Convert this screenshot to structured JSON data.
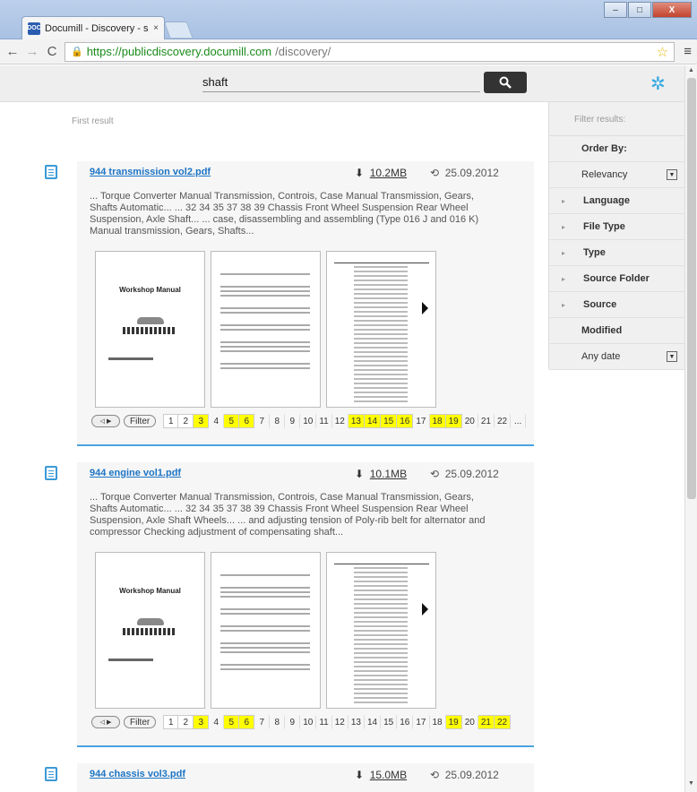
{
  "browser": {
    "tab_title": "Documill - Discovery - sha",
    "tab_close": "×",
    "favicon": "DOC",
    "url_https": "https://publicdiscovery.documill.com",
    "url_path": "/discovery/",
    "controls": {
      "minimize": "–",
      "maximize": "□",
      "close": "X"
    }
  },
  "search": {
    "query": "shaft",
    "button_icon": "search-icon"
  },
  "first_result_label": "First result",
  "results": [
    {
      "title": "944 transmission vol2.pdf",
      "size": "10.2MB",
      "date": "25.09.2012",
      "snippet": "... Torque Converter Manual Transmission, Controis, Case Manual Transmission, Gears, Shafts Automatic... ... 32 34 35 37 38 39 Chassis Front Wheel Suspension Rear Wheel Suspension, Axle Shaft... ... case, disassembling and assembling (Type 016 J and 016 K) Manual transmission, Gears, Shafts...",
      "thumb_title": "Workshop Manual",
      "filter_label": "Filter",
      "pages": [
        {
          "n": "1",
          "hl": false,
          "boxed": true
        },
        {
          "n": "2",
          "hl": false,
          "boxed": true
        },
        {
          "n": "3",
          "hl": true,
          "boxed": true
        },
        {
          "n": "4",
          "hl": false,
          "boxed": false
        },
        {
          "n": "5",
          "hl": true,
          "boxed": true
        },
        {
          "n": "6",
          "hl": true,
          "boxed": true
        },
        {
          "n": "7",
          "hl": false,
          "boxed": false
        },
        {
          "n": "8",
          "hl": false,
          "boxed": false
        },
        {
          "n": "9",
          "hl": false,
          "boxed": false
        },
        {
          "n": "10",
          "hl": false,
          "boxed": false
        },
        {
          "n": "11",
          "hl": false,
          "boxed": false
        },
        {
          "n": "12",
          "hl": false,
          "boxed": false
        },
        {
          "n": "13",
          "hl": true,
          "boxed": true
        },
        {
          "n": "14",
          "hl": true,
          "boxed": true
        },
        {
          "n": "15",
          "hl": true,
          "boxed": true
        },
        {
          "n": "16",
          "hl": true,
          "boxed": true
        },
        {
          "n": "17",
          "hl": false,
          "boxed": false
        },
        {
          "n": "18",
          "hl": true,
          "boxed": true
        },
        {
          "n": "19",
          "hl": true,
          "boxed": true
        },
        {
          "n": "20",
          "hl": false,
          "boxed": false
        },
        {
          "n": "21",
          "hl": false,
          "boxed": false
        },
        {
          "n": "22",
          "hl": false,
          "boxed": false
        },
        {
          "n": "...",
          "hl": false,
          "boxed": false
        }
      ]
    },
    {
      "title": "944 engine vol1.pdf",
      "size": "10.1MB",
      "date": "25.09.2012",
      "snippet": "... Torque Converter Manual Transmission, Controis, Case Manual Transmission, Gears, Shafts Automatic... ... 32 34 35 37 38 39 Chassis Front Wheel Suspension Rear Wheel Suspension, Axle Shaft Wheels... ... and adjusting tension of Poly-rib belt for alternator and compressor Checking adjustment of compensating shaft...",
      "thumb_title": "Workshop Manual",
      "filter_label": "Filter",
      "pages": [
        {
          "n": "1",
          "hl": false,
          "boxed": true
        },
        {
          "n": "2",
          "hl": false,
          "boxed": true
        },
        {
          "n": "3",
          "hl": true,
          "boxed": true
        },
        {
          "n": "4",
          "hl": false,
          "boxed": false
        },
        {
          "n": "5",
          "hl": true,
          "boxed": true
        },
        {
          "n": "6",
          "hl": true,
          "boxed": true
        },
        {
          "n": "7",
          "hl": false,
          "boxed": false
        },
        {
          "n": "8",
          "hl": false,
          "boxed": false
        },
        {
          "n": "9",
          "hl": false,
          "boxed": false
        },
        {
          "n": "10",
          "hl": false,
          "boxed": false
        },
        {
          "n": "11",
          "hl": false,
          "boxed": false
        },
        {
          "n": "12",
          "hl": false,
          "boxed": false
        },
        {
          "n": "13",
          "hl": false,
          "boxed": false
        },
        {
          "n": "14",
          "hl": false,
          "boxed": false
        },
        {
          "n": "15",
          "hl": false,
          "boxed": false
        },
        {
          "n": "16",
          "hl": false,
          "boxed": false
        },
        {
          "n": "17",
          "hl": false,
          "boxed": false
        },
        {
          "n": "18",
          "hl": false,
          "boxed": false
        },
        {
          "n": "19",
          "hl": true,
          "boxed": true
        },
        {
          "n": "20",
          "hl": false,
          "boxed": false
        },
        {
          "n": "21",
          "hl": true,
          "boxed": true
        },
        {
          "n": "22",
          "hl": true,
          "boxed": true
        }
      ]
    },
    {
      "title": "944 chassis vol3.pdf",
      "size": "15.0MB",
      "date": "25.09.2012"
    }
  ],
  "sidebar": {
    "header": "Filter results:",
    "order_by_label": "Order By:",
    "order_by_value": "Relevancy",
    "facets": [
      "Language",
      "File Type",
      "Type",
      "Source Folder",
      "Source"
    ],
    "modified_label": "Modified",
    "modified_value": "Any date"
  },
  "colors": {
    "accent": "#36a9e1",
    "link": "#1d74c4",
    "highlight": "#ffff00"
  }
}
